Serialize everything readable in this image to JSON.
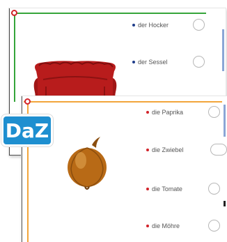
{
  "badge": {
    "label": "DaZ",
    "color": "#1e8fd0"
  },
  "back_card": {
    "accent_color": "#35a53a",
    "image": "armchair",
    "words": [
      {
        "label": "der Hocker"
      },
      {
        "label": "der Sessel"
      }
    ]
  },
  "front_card": {
    "accent_color": "#f2a53b",
    "image": "onion",
    "words": [
      {
        "label": "die Paprika"
      },
      {
        "label": "die Zwiebel"
      },
      {
        "label": "die Tomate"
      },
      {
        "label": "die Möhre"
      }
    ]
  },
  "icons": {
    "pin": "red-pin-icon",
    "answer": "answer-circle-icon"
  }
}
